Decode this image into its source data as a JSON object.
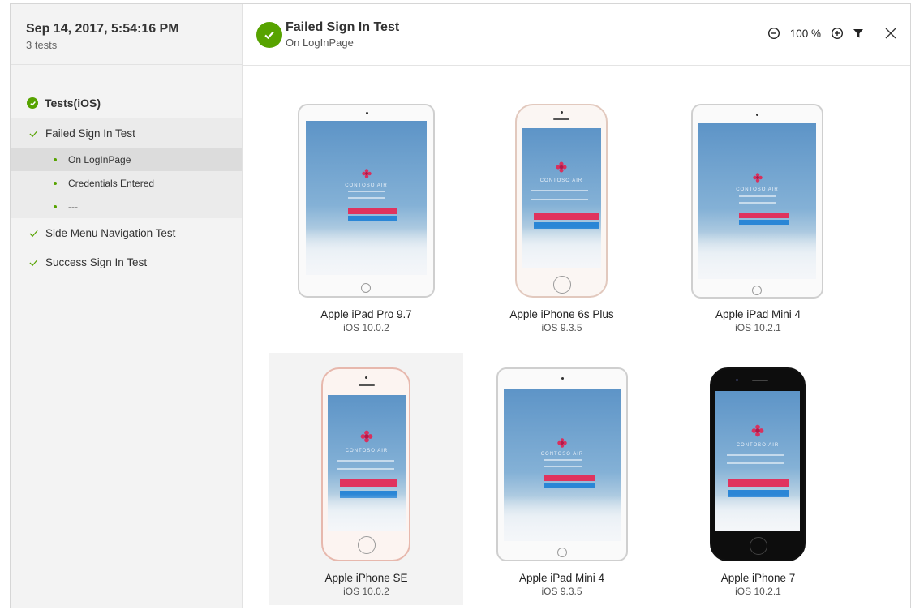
{
  "run": {
    "date": "Sep 14, 2017, 5:54:16 PM",
    "count": "3 tests"
  },
  "tree": {
    "root": "Tests(iOS)",
    "tests": [
      {
        "label": "Failed Sign In Test",
        "steps": [
          "On LogInPage",
          "Credentials Entered",
          "---"
        ]
      },
      {
        "label": "Side Menu Navigation Test"
      },
      {
        "label": "Success Sign In Test"
      }
    ],
    "selected_step": "On LogInPage"
  },
  "header": {
    "title": "Failed Sign In Test",
    "subtitle": "On LogInPage",
    "zoom": "100 %"
  },
  "devices": [
    {
      "name": "Apple iPad Pro 9.7",
      "os": "iOS 10.0.2"
    },
    {
      "name": "Apple iPhone 6s Plus",
      "os": "iOS 9.3.5"
    },
    {
      "name": "Apple iPad Mini 4",
      "os": "iOS 10.2.1"
    },
    {
      "name": "Apple iPhone SE",
      "os": "iOS 10.0.2"
    },
    {
      "name": "Apple iPad Mini 4",
      "os": "iOS 9.3.5"
    },
    {
      "name": "Apple iPhone 7",
      "os": "iOS 10.2.1"
    }
  ],
  "screenshot_brand": "CONTOSO AIR",
  "colors": {
    "success": "#57a300",
    "accent_red": "#e0335e",
    "accent_blue": "#2a86d6"
  },
  "icons": [
    "check-circle-icon",
    "check-icon",
    "bullet-icon",
    "zoom-out-icon",
    "zoom-in-icon",
    "filter-icon",
    "close-icon"
  ]
}
